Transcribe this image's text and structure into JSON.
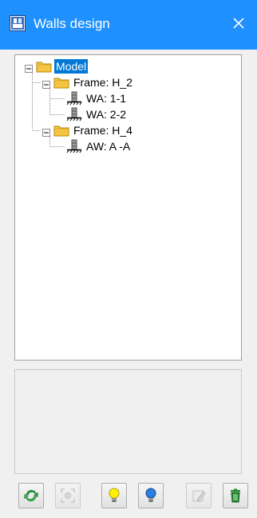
{
  "window": {
    "title": "Walls design",
    "icon": "walls-design-app-icon",
    "close_icon": "close-icon"
  },
  "tree": {
    "root": {
      "label": "Model",
      "selected": true,
      "expanded": true,
      "icon": "folder-icon",
      "children": [
        {
          "label": "Frame: H_2",
          "expanded": true,
          "icon": "folder-icon",
          "children": [
            {
              "label": "WA: 1-1",
              "icon": "wall-element-icon"
            },
            {
              "label": "WA: 2-2",
              "icon": "wall-element-icon"
            }
          ]
        },
        {
          "label": "Frame: H_4",
          "expanded": true,
          "icon": "folder-icon",
          "children": [
            {
              "label": "AW: A -A",
              "icon": "wall-element-icon"
            }
          ]
        }
      ]
    }
  },
  "toolbar": {
    "buttons": [
      {
        "name": "refresh-button",
        "icon": "refresh-icon",
        "enabled": true
      },
      {
        "name": "zoom-extents-button",
        "icon": "zoom-extents-icon",
        "enabled": false
      },
      {
        "name": "yellow-bulb-button",
        "icon": "yellow-lightbulb-icon",
        "enabled": true
      },
      {
        "name": "blue-bulb-button",
        "icon": "blue-lightbulb-icon",
        "enabled": true
      },
      {
        "name": "edit-button",
        "icon": "edit-icon",
        "enabled": false
      },
      {
        "name": "delete-button",
        "icon": "trash-icon",
        "enabled": true
      }
    ]
  },
  "colors": {
    "titlebar": "#1e90ff",
    "selection": "#0078d7",
    "folder": "#f5c542",
    "refresh": "#2ea043",
    "trash": "#1f8a2e"
  }
}
